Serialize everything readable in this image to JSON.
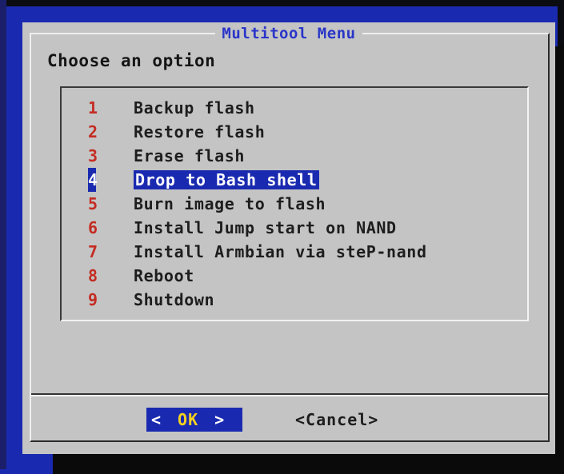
{
  "dialog": {
    "title": "Multitool Menu",
    "prompt": "Choose an option"
  },
  "menu": {
    "selected_index": 4,
    "items": [
      {
        "key": "1",
        "label": "Backup flash"
      },
      {
        "key": "2",
        "label": "Restore flash"
      },
      {
        "key": "3",
        "label": "Erase flash"
      },
      {
        "key": "4",
        "label": "Drop to Bash shell"
      },
      {
        "key": "5",
        "label": "Burn image to flash"
      },
      {
        "key": "6",
        "label": "Install Jump start on NAND"
      },
      {
        "key": "7",
        "label": "Install Armbian via steP-nand"
      },
      {
        "key": "8",
        "label": "Reboot"
      },
      {
        "key": "9",
        "label": "Shutdown"
      }
    ]
  },
  "buttons": {
    "ok_left": "<",
    "ok_label": "OK",
    "ok_right": ">",
    "cancel_label": "<Cancel>"
  },
  "colors": {
    "background": "#1a2ab0",
    "dialog": "#c4c4c4",
    "title": "#2a35c8",
    "hotkey": "#c42b22",
    "highlight": "#1a2ab0",
    "ok_text": "#f5d21f"
  }
}
